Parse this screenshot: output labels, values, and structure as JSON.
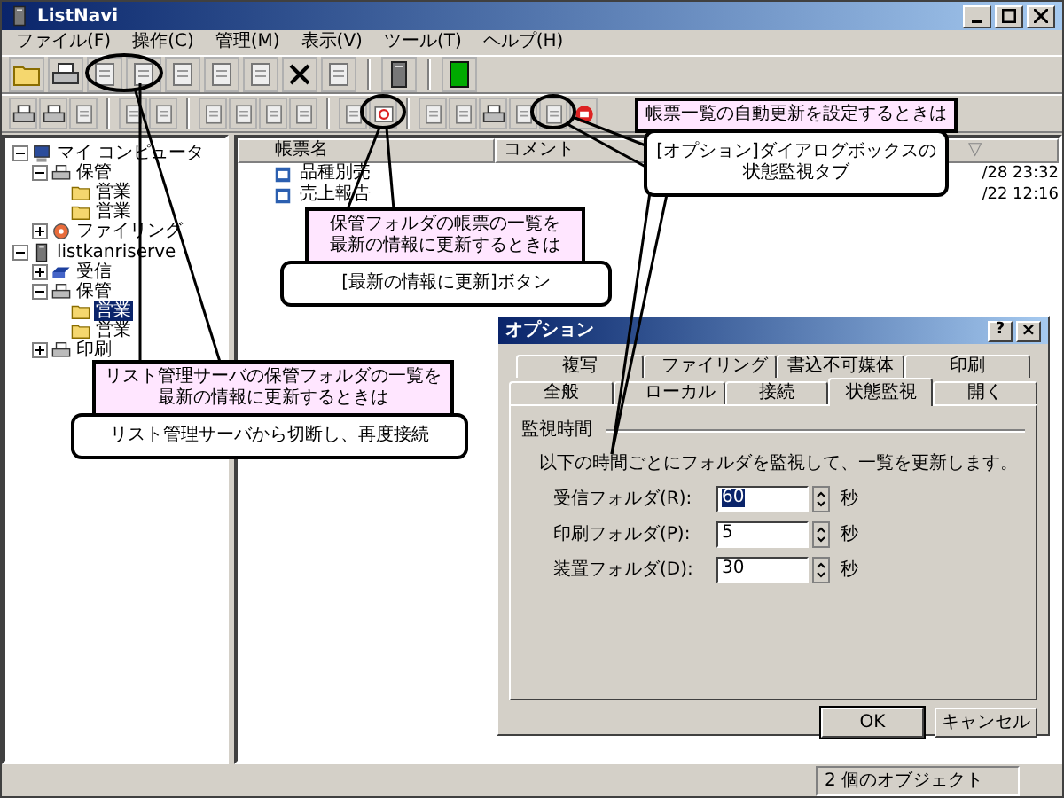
{
  "window": {
    "title": "ListNavi"
  },
  "menu": [
    "ファイル(F)",
    "操作(C)",
    "管理(M)",
    "表示(V)",
    "ツール(T)",
    "ヘルプ(H)"
  ],
  "tree": [
    {
      "label": "マイ コンピュータ",
      "kind": "computer",
      "expanded": true,
      "children": [
        {
          "label": "保管",
          "kind": "printer",
          "expanded": true,
          "children": [
            {
              "label": "営業",
              "kind": "folder",
              "selected": false
            },
            {
              "label": "営業",
              "kind": "folder",
              "selected": false
            }
          ]
        },
        {
          "label": "ファイリング",
          "kind": "filing",
          "expanded": false
        }
      ]
    },
    {
      "label": "listkanriserve",
      "kind": "server",
      "expanded": true,
      "children": [
        {
          "label": "受信",
          "kind": "inbox",
          "expanded": false
        },
        {
          "label": "保管",
          "kind": "printer",
          "expanded": true,
          "children": [
            {
              "label": "営業",
              "kind": "folder",
              "selected": true
            },
            {
              "label": "営業",
              "kind": "folder",
              "selected": false
            }
          ]
        },
        {
          "label": "印刷",
          "kind": "printer",
          "expanded": false
        }
      ]
    }
  ],
  "list": {
    "columns": [
      "帳票名",
      "コメント",
      "▽"
    ],
    "rows": [
      {
        "name": "品種別売",
        "date": "/28 23:32"
      },
      {
        "name": "売上報告",
        "date": "/22 12:16"
      }
    ]
  },
  "dialog": {
    "title": "オプション",
    "help": "?",
    "close": "×",
    "tab_rows": [
      [
        {
          "label": "複写",
          "selected": false
        },
        {
          "label": "ファイリング",
          "selected": false
        },
        {
          "label": "書込不可媒体",
          "selected": false
        },
        {
          "label": "印刷",
          "selected": false
        }
      ],
      [
        {
          "label": "全般",
          "selected": false
        },
        {
          "label": "ローカル",
          "selected": false
        },
        {
          "label": "接続",
          "selected": false
        },
        {
          "label": "状態監視",
          "selected": true
        },
        {
          "label": "開く",
          "selected": false
        }
      ]
    ],
    "group": "監視時間",
    "description": "以下の時間ごとにフォルダを監視して、一覧を更新します。",
    "fields": [
      {
        "label": "受信フォルダ(R):",
        "value": "60",
        "unit": "秒",
        "highlighted": true
      },
      {
        "label": "印刷フォルダ(P):",
        "value": "5",
        "unit": "秒",
        "highlighted": false
      },
      {
        "label": "装置フォルダ(D):",
        "value": "30",
        "unit": "秒",
        "highlighted": false
      }
    ],
    "buttons": [
      "OK",
      "キャンセル"
    ]
  },
  "callouts": [
    {
      "title": [
        "帳票一覧の自動更新を設定するときは"
      ],
      "note": [
        "[オプション]ダイアログボックスの",
        "状態監視タブ"
      ]
    },
    {
      "title": [
        "保管フォルダの帳票の一覧を",
        "最新の情報に更新するときは"
      ],
      "note": [
        "[最新の情報に更新]ボタン"
      ]
    },
    {
      "title": [
        "リスト管理サーバの保管フォルダの一覧を",
        "最新の情報に更新するときは"
      ],
      "note": [
        "リスト管理サーバから切断し、再度接続"
      ]
    }
  ],
  "status_bar": "2 個のオブジェクト"
}
